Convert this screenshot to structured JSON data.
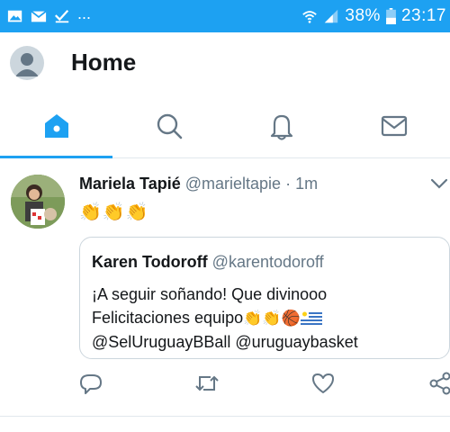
{
  "status_bar": {
    "battery": "38%",
    "time": "23:17",
    "more": "...",
    "icons": [
      "image-icon",
      "mail-icon",
      "check-icon",
      "wifi-icon",
      "signal-icon",
      "battery-icon"
    ]
  },
  "header": {
    "title": "Home",
    "avatar_icon": "default-avatar-icon"
  },
  "tabs": [
    {
      "icon": "home-icon",
      "active": true
    },
    {
      "icon": "search-icon",
      "active": false
    },
    {
      "icon": "notifications-icon",
      "active": false
    },
    {
      "icon": "messages-icon",
      "active": false
    }
  ],
  "tweet": {
    "author_name": "Mariela Tapié",
    "author_handle": "@marieltapie",
    "separator": "·",
    "time": "1m",
    "emojis": [
      "👏",
      "👏",
      "👏"
    ],
    "quote": {
      "name": "Karen Todoroff",
      "handle": "@karentodoroff",
      "line1": "¡A seguir soñando! Que divinooo",
      "line2_text": "Felicitaciones equipo",
      "line2_emojis": [
        "👏",
        "👏",
        "🏀"
      ],
      "line3": "@SelUruguayBBall @uruguaybasket"
    },
    "actions": [
      "reply-icon",
      "retweet-icon",
      "like-icon",
      "share-icon"
    ]
  },
  "colors": {
    "accent": "#1da1f2",
    "text_primary": "#14171a",
    "text_secondary": "#657786",
    "border": "#ccd6dd"
  }
}
